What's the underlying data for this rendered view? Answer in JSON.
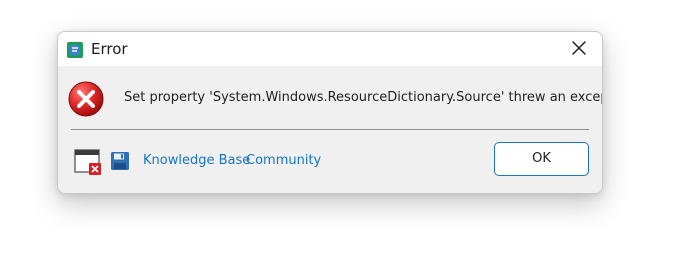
{
  "window": {
    "title": "Error",
    "close_icon": "close-icon",
    "app_icon": "app-icon"
  },
  "content": {
    "message": "Set property 'System.Windows.ResourceDictionary.Source' threw an exception.",
    "icon": "error-icon"
  },
  "footer": {
    "links": [
      {
        "label": "Knowledge Base"
      },
      {
        "label": "Community"
      }
    ],
    "ok_label": "OK",
    "icons": [
      "window-error-icon",
      "save-icon"
    ]
  },
  "colors": {
    "link": "#1775c8",
    "error_red": "#d81f26",
    "button_border": "#1e73c8"
  }
}
